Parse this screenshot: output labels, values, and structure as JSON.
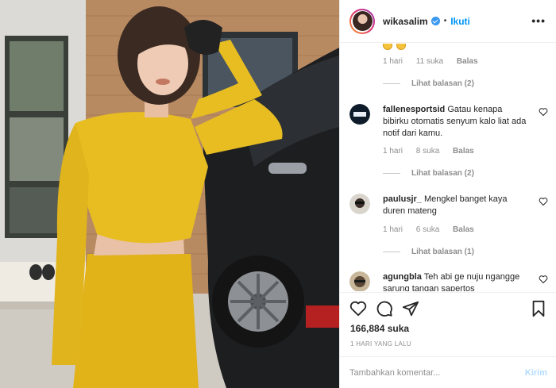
{
  "post": {
    "photo_icon": "photo-of-woman-in-yellow-outfit-beside-black-car"
  },
  "header": {
    "username": "wikasalim",
    "verified_icon": "verified-badge-icon",
    "separator": "•",
    "follow_label": "Ikuti",
    "more_icon": "more-options-icon"
  },
  "comments": {
    "first_meta": {
      "time": "1 hari",
      "likes": "11 suka",
      "reply": "Balas"
    },
    "first_replies": "Lihat balasan (2)",
    "items": [
      {
        "username": "fallenesportsid",
        "text": "Gatau kenapa bibirku otomatis senyum kalo liat ada notif dari kamu.",
        "time": "1 hari",
        "likes": "8 suka",
        "reply": "Balas",
        "replies": "Lihat balasan (2)"
      },
      {
        "username": "paulusjr_",
        "text": "Mengkel banget kaya duren mateng",
        "time": "1 hari",
        "likes": "6 suka",
        "reply": "Balas",
        "replies": "Lihat balasan (1)"
      },
      {
        "username": "agungbla",
        "text": "Teh abi ge nuju ngangge sarung tangan sapertos"
      }
    ]
  },
  "actions": {
    "like_icon": "heart-icon",
    "comment_icon": "comment-icon",
    "share_icon": "share-icon",
    "save_icon": "bookmark-icon",
    "likes_count": "166,884 suka",
    "date": "1 HARI YANG LALU"
  },
  "add_comment": {
    "placeholder": "Tambahkan komentar...",
    "post_label": "Kirim"
  }
}
